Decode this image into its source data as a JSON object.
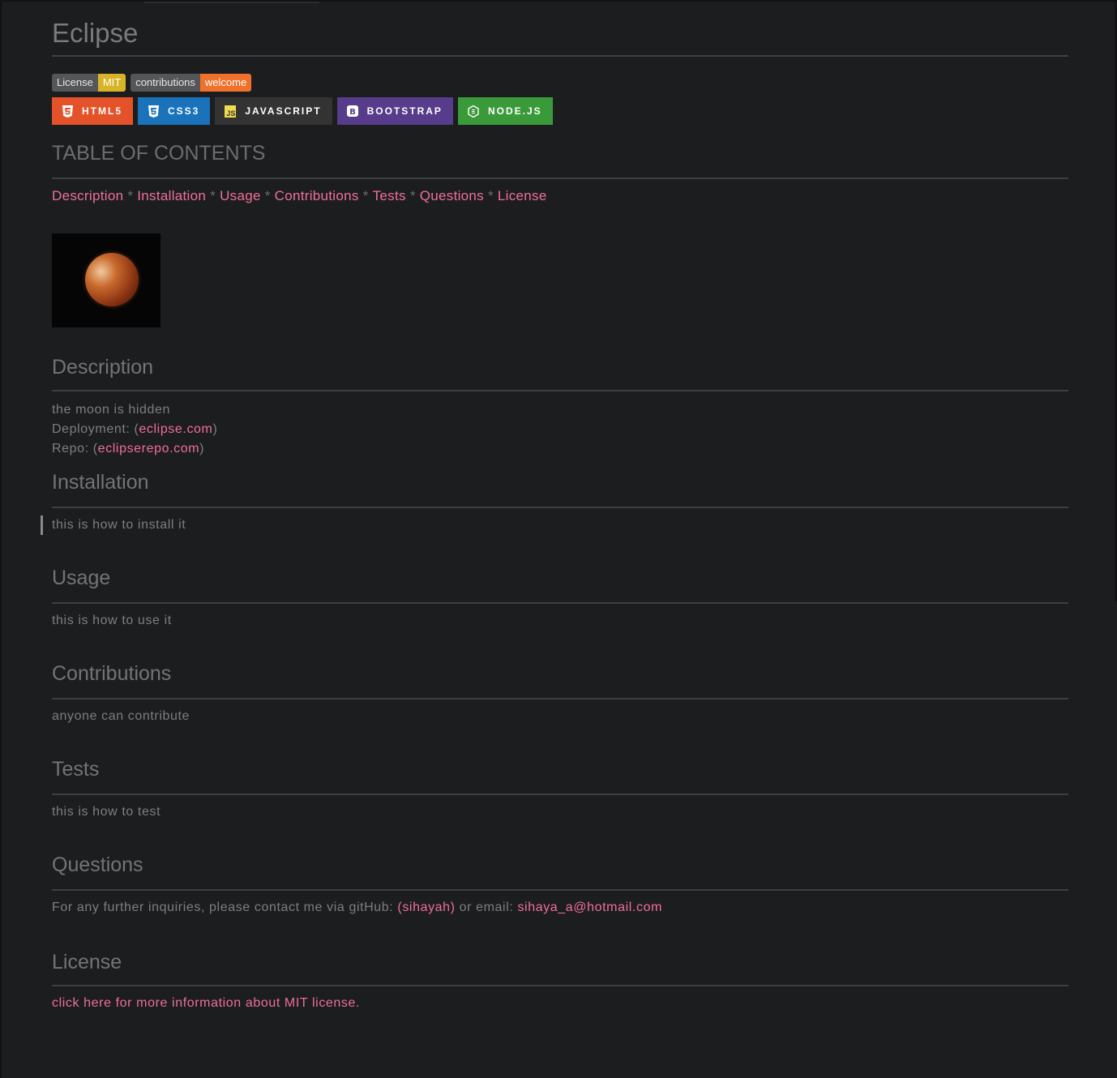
{
  "title": "Eclipse",
  "shield_badges": [
    {
      "label": "License",
      "value": "MIT",
      "color": "#d8b328"
    },
    {
      "label": "contributions",
      "value": "welcome",
      "color": "#f0712c"
    }
  ],
  "tech_badges": [
    {
      "label": "HTML5",
      "icon": "html5-icon",
      "color": "#e4522a"
    },
    {
      "label": "CSS3",
      "icon": "css3-icon",
      "color": "#1a72bb"
    },
    {
      "label": "JAVASCRIPT",
      "icon": "javascript-icon",
      "color": "#323332"
    },
    {
      "label": "BOOTSTRAP",
      "icon": "bootstrap-icon",
      "color": "#563c8a"
    },
    {
      "label": "NODE.JS",
      "icon": "nodejs-icon",
      "color": "#3a9a3a"
    }
  ],
  "toc": {
    "heading": "TABLE OF CONTENTS",
    "separator": "*",
    "items": [
      "Description",
      "Installation",
      "Usage",
      "Contributions",
      "Tests",
      "Questions",
      "License"
    ]
  },
  "description": {
    "heading": "Description",
    "text": "the moon is hidden",
    "deployment_label": "Deployment: (",
    "deployment_link": "eclipse.com",
    "repo_label": "Repo: (",
    "repo_link": "eclipserepo.com",
    "close_paren": ")"
  },
  "installation": {
    "heading": "Installation",
    "text": "this is how to install it"
  },
  "usage": {
    "heading": "Usage",
    "text": "this is how to use it"
  },
  "contributions": {
    "heading": "Contributions",
    "text": "anyone can contribute"
  },
  "tests": {
    "heading": "Tests",
    "text": "this is how to test"
  },
  "questions": {
    "heading": "Questions",
    "text_before": "For any further inquiries, please contact me via gitHub: ",
    "github_link": "(sihayah)",
    "text_middle": " or email: ",
    "email_link": "sihaya_a@hotmail.com"
  },
  "license": {
    "heading": "License",
    "link": "click here for more information about MIT license."
  },
  "colors": {
    "background": "#1c1d1f",
    "link": "#f06f97",
    "text": "#7d7e81",
    "rule": "#3e3f42"
  }
}
